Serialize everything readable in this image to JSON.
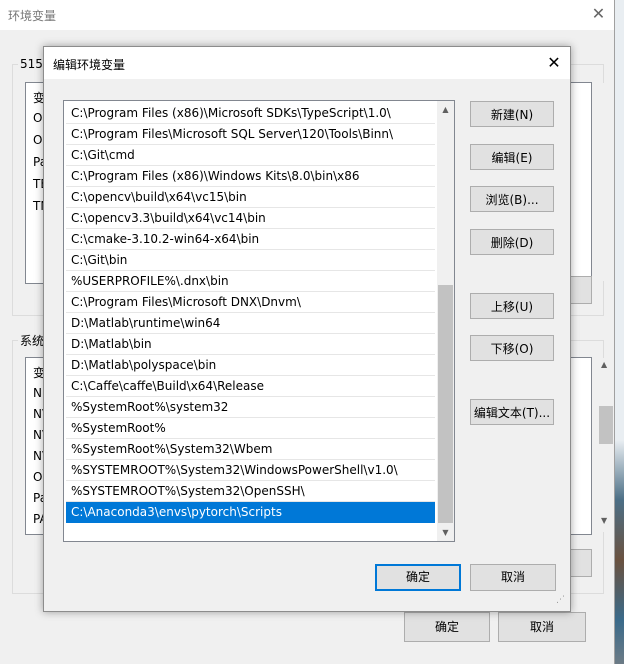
{
  "background_window": {
    "title": "环境变量",
    "user_group_label": "515",
    "user_rows": [
      "变",
      "On",
      "On",
      "Pa",
      "TE",
      "TN"
    ],
    "system_group_label": "系统",
    "system_rows": [
      "变",
      "NU",
      "NV",
      "NV",
      "NV",
      "OS",
      "Pa",
      "PA"
    ],
    "ok_label": "确定",
    "cancel_label": "取消"
  },
  "dialog": {
    "title": "编辑环境变量",
    "paths": [
      "C:\\Program Files (x86)\\Microsoft SDKs\\TypeScript\\1.0\\",
      "C:\\Program Files\\Microsoft SQL Server\\120\\Tools\\Binn\\",
      "C:\\Git\\cmd",
      "C:\\Program Files (x86)\\Windows Kits\\8.0\\bin\\x86",
      "C:\\opencv\\build\\x64\\vc15\\bin",
      "C:\\opencv3.3\\build\\x64\\vc14\\bin",
      "C:\\cmake-3.10.2-win64-x64\\bin",
      "C:\\Git\\bin",
      "%USERPROFILE%\\.dnx\\bin",
      "C:\\Program Files\\Microsoft DNX\\Dnvm\\",
      "D:\\Matlab\\runtime\\win64",
      "D:\\Matlab\\bin",
      "D:\\Matlab\\polyspace\\bin",
      "C:\\Caffe\\caffe\\Build\\x64\\Release",
      "%SystemRoot%\\system32",
      "%SystemRoot%",
      "%SystemRoot%\\System32\\Wbem",
      "%SYSTEMROOT%\\System32\\WindowsPowerShell\\v1.0\\",
      "%SYSTEMROOT%\\System32\\OpenSSH\\",
      "C:\\Anaconda3\\envs\\pytorch\\Scripts"
    ],
    "selected_index": 19,
    "buttons": {
      "new": "新建(N)",
      "edit": "编辑(E)",
      "browse": "浏览(B)...",
      "delete": "删除(D)",
      "move_up": "上移(U)",
      "move_down": "下移(O)",
      "edit_text": "编辑文本(T)..."
    },
    "ok_label": "确定",
    "cancel_label": "取消"
  },
  "icons": {
    "close": "close-icon",
    "scroll_up": "chevron-up-icon",
    "scroll_down": "chevron-down-icon",
    "resize_grip": "resize-grip-icon"
  },
  "colors": {
    "selection": "#0078d7",
    "dialog_bg": "#f0f0f0",
    "button_bg": "#e1e1e1"
  }
}
